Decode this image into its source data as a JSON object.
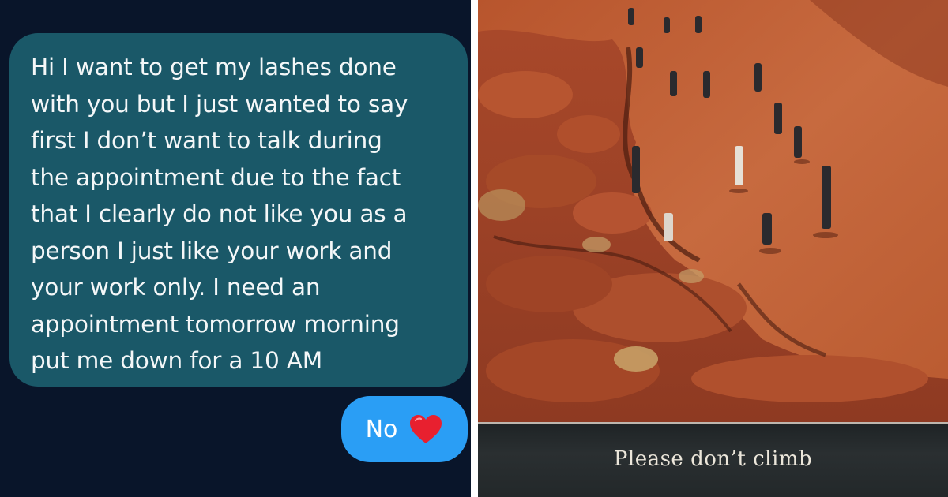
{
  "chat": {
    "incoming_message": "Hi I want to get my lashes done\nwith you but I just wanted to say\nfirst I don’t want to talk during\nthe appointment due to the fact\nthat I clearly do not like you as a\nperson I just like your work and\nyour work only. I need an\nappointment tomorrow morning\nput me down for a 10 AM",
    "reply_text": "No",
    "reply_emoji": "red-heart-icon",
    "colors": {
      "background": "#09152a",
      "incoming_bubble": "#1a5868",
      "outgoing_bubble": "#2a9ef5",
      "heart": "#e8202f"
    }
  },
  "photo": {
    "sign_text": "Please don’t climb",
    "colors": {
      "rock": "#b3542c",
      "sign": "#23282a"
    }
  }
}
